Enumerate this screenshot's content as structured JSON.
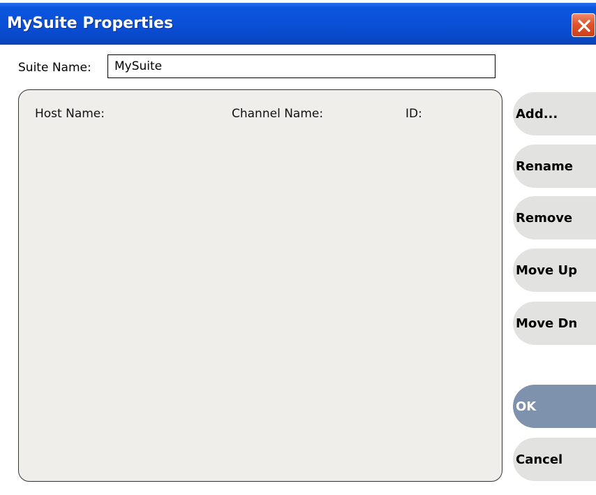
{
  "window": {
    "title": "MySuite Properties"
  },
  "suite_name": {
    "label": "Suite Name:",
    "value": "MySuite"
  },
  "list": {
    "columns": [
      "Host Name:",
      "Channel Name:",
      "ID:"
    ],
    "rows": []
  },
  "buttons": {
    "add": "Add...",
    "rename": "Rename",
    "remove": "Remove",
    "move_up": "Move Up",
    "move_dn": "Move Dn",
    "ok": "OK",
    "cancel": "Cancel"
  },
  "colors": {
    "titlebar": "#0a4fd6",
    "close_button": "#e0552f",
    "panel": "#efeeeb",
    "side_button": "#e2e2e0",
    "ok_button": "#7e92ad"
  },
  "icons": {
    "close": "close-icon"
  }
}
